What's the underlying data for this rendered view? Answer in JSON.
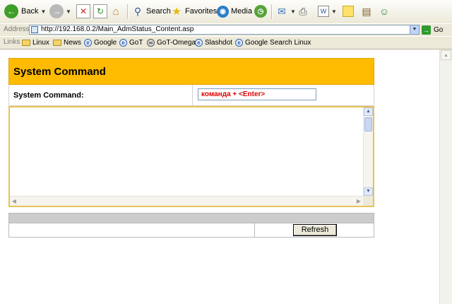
{
  "toolbar": {
    "back_label": "Back",
    "search_label": "Search",
    "favorites_label": "Favorites",
    "media_label": "Media"
  },
  "address_bar": {
    "label": "Address",
    "url": "http://192.168.0.2/Main_AdmStatus_Content.asp",
    "go_label": "Go"
  },
  "links_bar": {
    "label": "Links",
    "items": [
      "Linux",
      "News",
      "Google",
      "GoT",
      "GoT-Omega",
      "Slashdot",
      "Google Search Linux"
    ]
  },
  "page": {
    "title": "System Command",
    "command_label": "System Command:",
    "command_value": "команда + <Enter>",
    "output_text": "",
    "refresh_label": "Refresh"
  },
  "colors": {
    "header_accent": "#ffbb00",
    "command_text": "#e00000",
    "toolbar_bg": "#ece9d8"
  }
}
